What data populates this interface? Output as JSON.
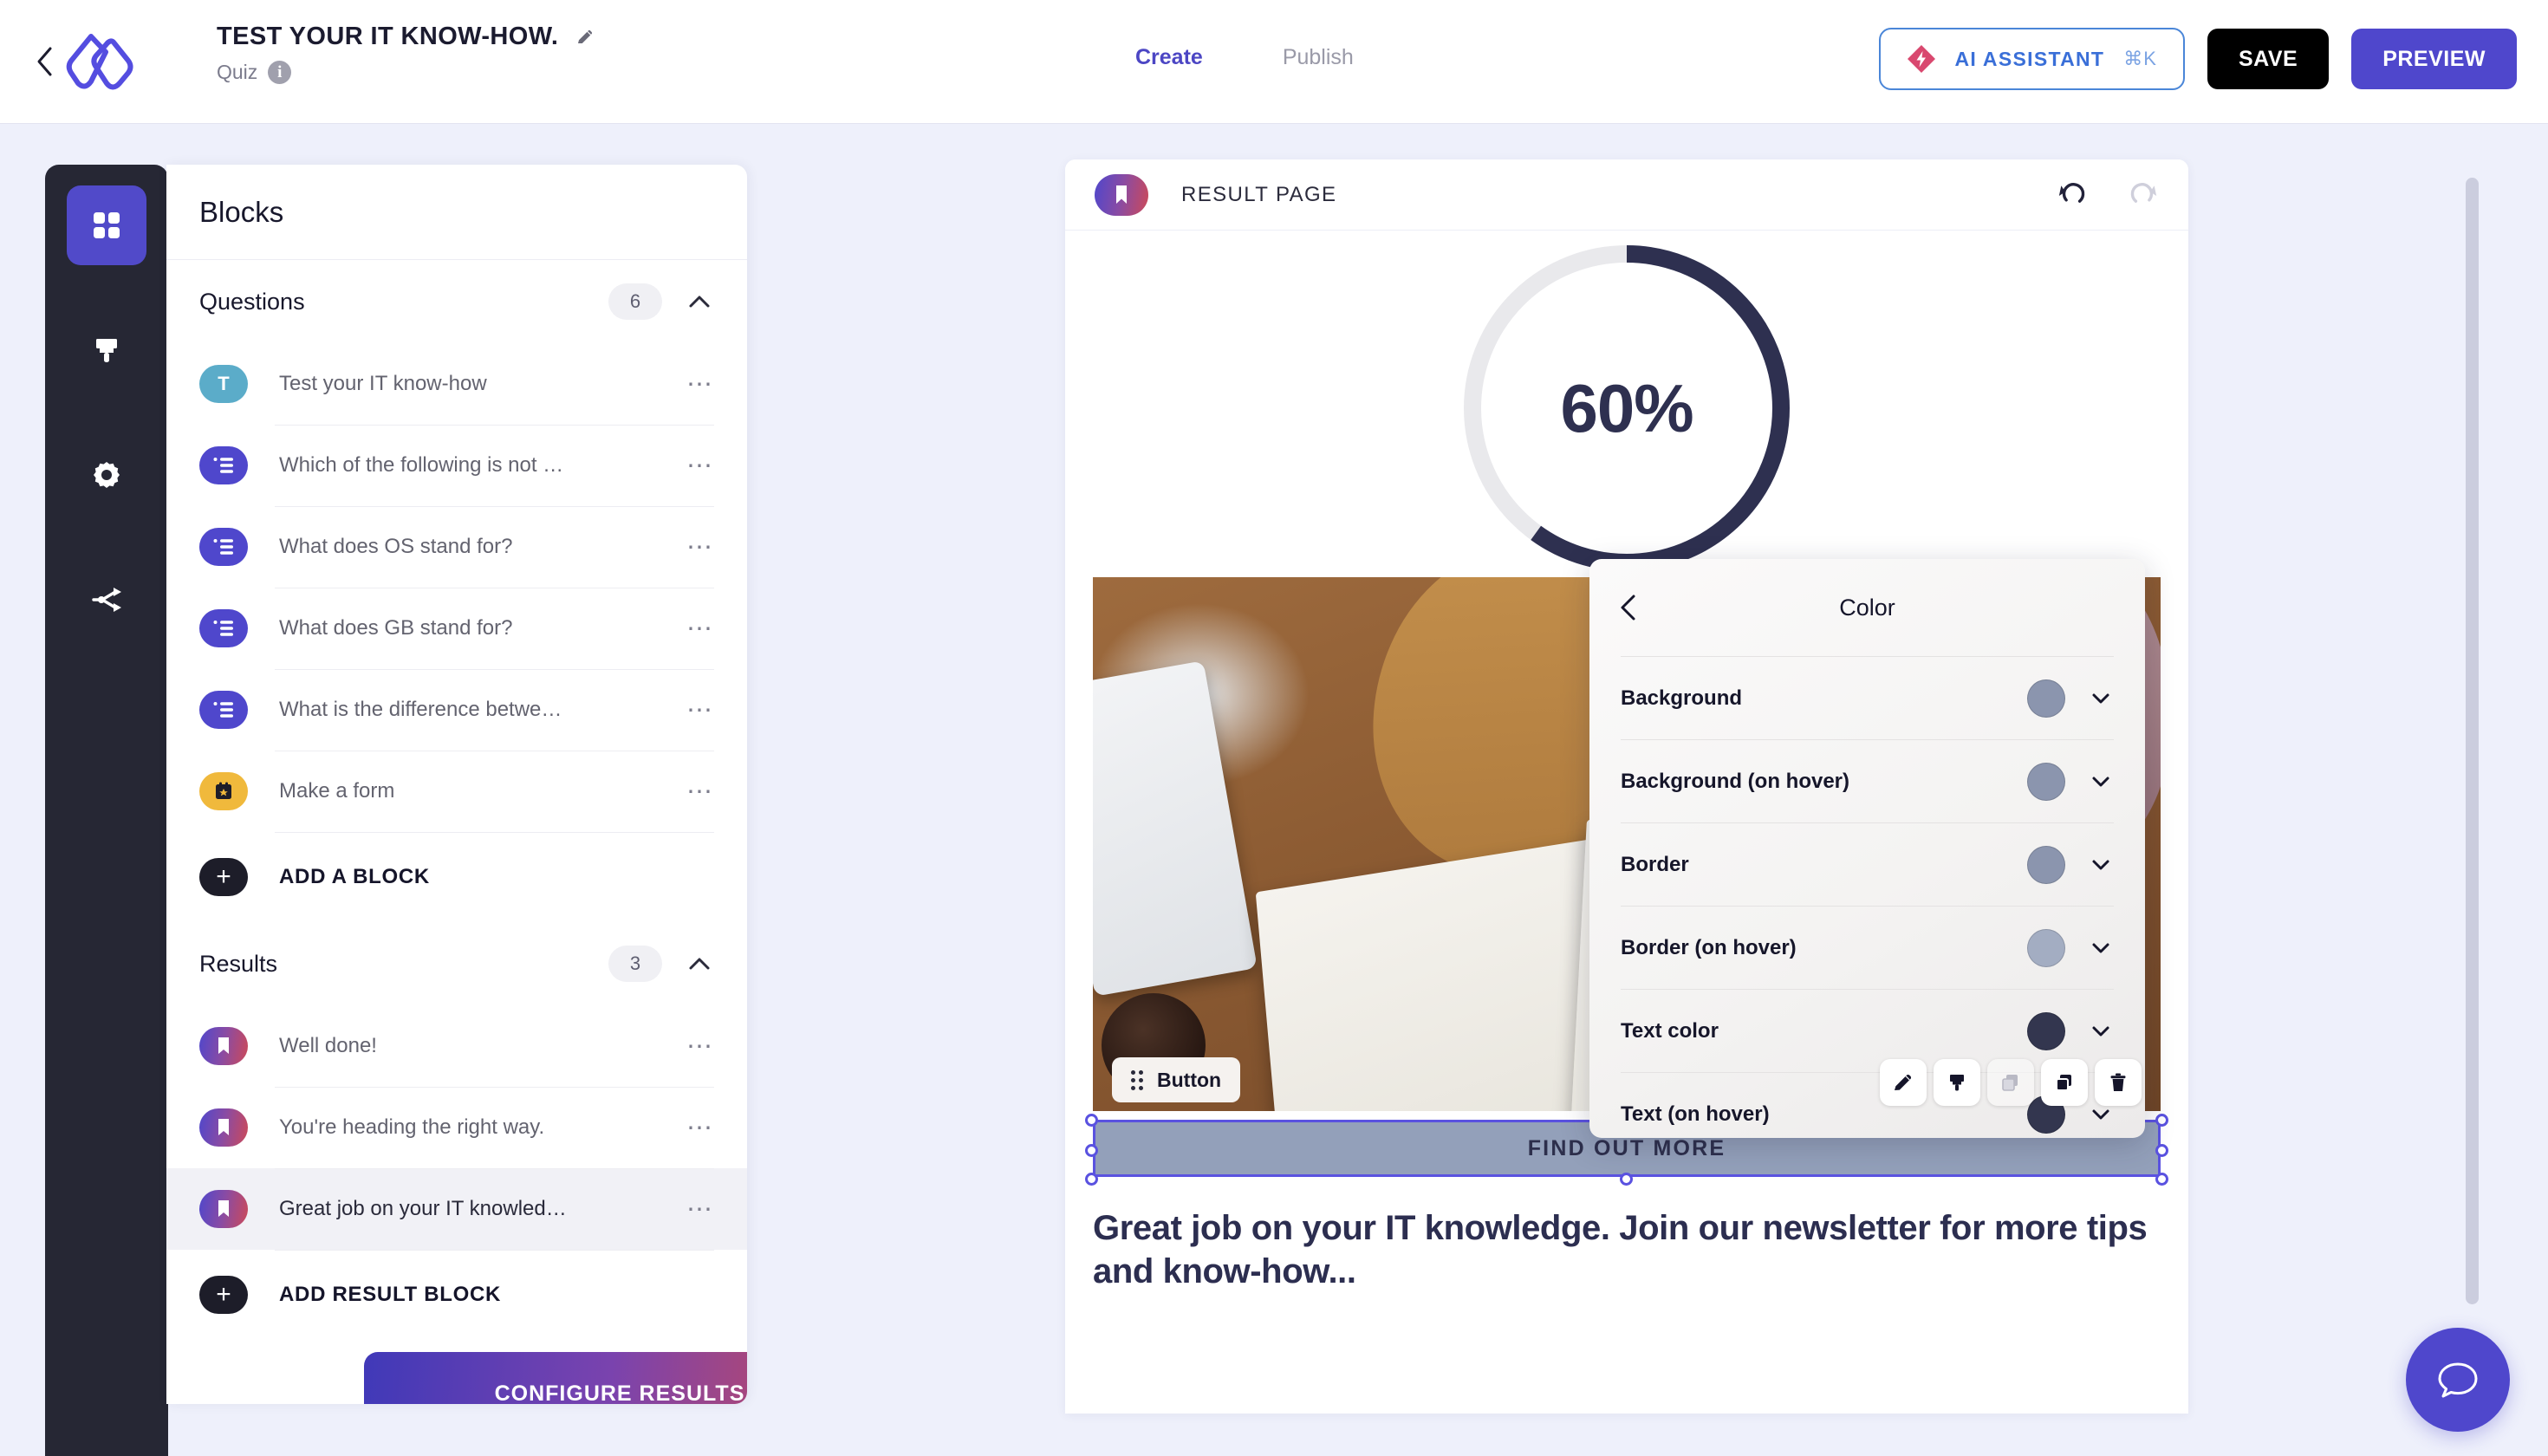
{
  "header": {
    "back_icon": "chevron-left-icon",
    "logo_icon": "brand-logo-icon",
    "title": "TEST YOUR IT KNOW-HOW.",
    "edit_icon": "pencil-icon",
    "subtitle": "Quiz",
    "info_icon": "info-icon",
    "info_glyph": "i",
    "tabs": [
      {
        "label": "Create",
        "active": true
      },
      {
        "label": "Publish",
        "active": false
      }
    ],
    "ai_button": {
      "label": "AI ASSISTANT",
      "shortcut": "⌘K",
      "icon": "ai-diamond-icon"
    },
    "save_label": "SAVE",
    "preview_label": "PREVIEW"
  },
  "rail": {
    "items": [
      {
        "icon": "blocks-grid-icon",
        "name": "blocks",
        "active": true
      },
      {
        "icon": "paintbrush-icon",
        "name": "design",
        "active": false
      },
      {
        "icon": "gear-icon",
        "name": "settings",
        "active": false
      },
      {
        "icon": "share-branch-icon",
        "name": "logic",
        "active": false
      }
    ]
  },
  "panel": {
    "title": "Blocks",
    "sections": [
      {
        "name": "Questions",
        "count": "6",
        "collapse_icon": "chevron-up-icon",
        "items": [
          {
            "label": "Test your IT know-how",
            "icon_kind": "ic-text",
            "glyph": "T",
            "selected": false
          },
          {
            "label": "Which of the following is not …",
            "icon_kind": "ic-choice",
            "glyph": "",
            "selected": false
          },
          {
            "label": "What does OS stand for?",
            "icon_kind": "ic-choice",
            "glyph": "",
            "selected": false
          },
          {
            "label": "What does GB stand for?",
            "icon_kind": "ic-choice",
            "glyph": "",
            "selected": false
          },
          {
            "label": "What is the difference betwe…",
            "icon_kind": "ic-choice",
            "glyph": "",
            "selected": false
          },
          {
            "label": "Make a form",
            "icon_kind": "ic-form",
            "glyph": "",
            "selected": false
          }
        ],
        "add_label": "ADD A BLOCK"
      },
      {
        "name": "Results",
        "count": "3",
        "collapse_icon": "chevron-up-icon",
        "items": [
          {
            "label": "Well done!",
            "icon_kind": "ic-result",
            "glyph": "",
            "selected": false
          },
          {
            "label": "You're heading the right way.",
            "icon_kind": "ic-result",
            "glyph": "",
            "selected": false
          },
          {
            "label": "Great job on your IT knowled…",
            "icon_kind": "ic-result",
            "glyph": "",
            "selected": true
          }
        ],
        "add_label": "ADD RESULT BLOCK"
      }
    ],
    "configure_label": "CONFIGURE RESULTS"
  },
  "canvas": {
    "page_icon": "bookmark-icon",
    "page_label": "RESULT PAGE",
    "undo_icon": "undo-icon",
    "redo_icon": "redo-icon",
    "score": {
      "value": "60%",
      "percent": 60,
      "track_color": "#e9e9ec",
      "fill_color": "#2e3050"
    },
    "image_alt": "people-at-wooden-table-photo",
    "element_tag": {
      "label": "Button",
      "grip_icon": "drag-grip-icon"
    },
    "element_toolbar": [
      {
        "icon": "pencil-icon",
        "name": "edit",
        "disabled": false
      },
      {
        "icon": "paintbrush-icon",
        "name": "style",
        "disabled": false
      },
      {
        "icon": "layers-icon",
        "name": "layers",
        "disabled": true
      },
      {
        "icon": "duplicate-icon",
        "name": "duplicate",
        "disabled": false
      },
      {
        "icon": "trash-icon",
        "name": "delete",
        "disabled": false
      }
    ],
    "cta_label": "FIND OUT MORE",
    "result_text": "Great job on your IT knowledge. Join our newsletter for more tips and know-how..."
  },
  "color_popover": {
    "back_icon": "chevron-left-icon",
    "title": "Color",
    "rows": [
      {
        "label": "Background",
        "swatch": "#8b95ae"
      },
      {
        "label": "Background (on hover)",
        "swatch": "#8b95ae"
      },
      {
        "label": "Border",
        "swatch": "#8b95ae"
      },
      {
        "label": "Border (on hover)",
        "swatch": "#a3adc2"
      },
      {
        "label": "Text color",
        "swatch": "#33364f"
      },
      {
        "label": "Text (on hover)",
        "swatch": "#33364f"
      }
    ],
    "expand_icon": "chevron-down-icon"
  },
  "chat": {
    "icon": "chat-bubble-icon"
  },
  "scrollbar": {
    "name": "vertical-scrollbar"
  }
}
